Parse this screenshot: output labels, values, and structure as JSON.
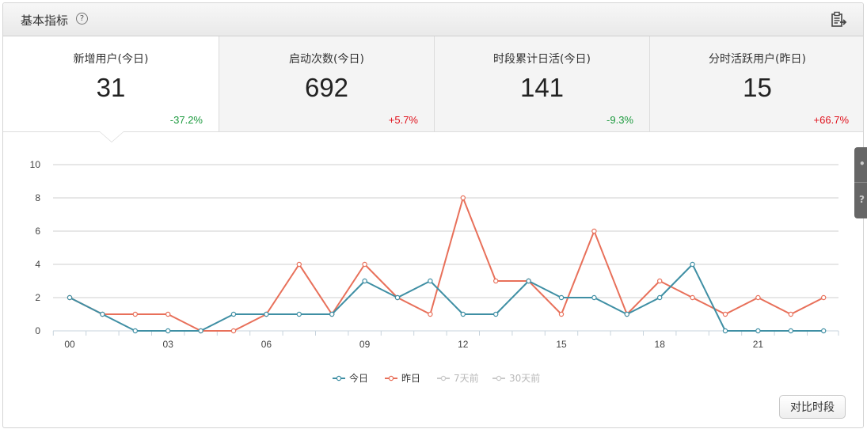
{
  "header": {
    "title": "基本指标",
    "help_icon": "?"
  },
  "kpis": [
    {
      "label": "新增用户(今日)",
      "value": "31",
      "change": "-37.2%",
      "trend": "down"
    },
    {
      "label": "启动次数(今日)",
      "value": "692",
      "change": "+5.7%",
      "trend": "up"
    },
    {
      "label": "时段累计日活(今日)",
      "value": "141",
      "change": "-9.3%",
      "trend": "down"
    },
    {
      "label": "分时活跃用户(昨日)",
      "value": "15",
      "change": "+66.7%",
      "trend": "up"
    }
  ],
  "compare_button": "对比时段",
  "colors": {
    "today": "#3f8fa4",
    "yesterday": "#e8705a",
    "inactive": "#c9c9c9",
    "grid": "#cfcfcf"
  },
  "chart_data": {
    "type": "line",
    "x": [
      "00",
      "01",
      "02",
      "03",
      "04",
      "05",
      "06",
      "07",
      "08",
      "09",
      "10",
      "11",
      "12",
      "13",
      "14",
      "15",
      "16",
      "17",
      "18",
      "19",
      "20",
      "21",
      "22",
      "23"
    ],
    "tick_labels": [
      "00",
      "03",
      "06",
      "09",
      "12",
      "15",
      "18",
      "21"
    ],
    "ylim": [
      0,
      10
    ],
    "yticks": [
      "0",
      "2",
      "4",
      "6",
      "8",
      "10"
    ],
    "grid": true,
    "legend_position": "bottom",
    "series": [
      {
        "name": "今日",
        "active": true,
        "values": [
          2,
          1,
          0,
          0,
          0,
          1,
          1,
          1,
          1,
          3,
          2,
          3,
          1,
          1,
          3,
          2,
          2,
          1,
          2,
          4,
          0,
          0,
          0,
          0
        ]
      },
      {
        "name": "昨日",
        "active": true,
        "values": [
          2,
          1,
          1,
          1,
          0,
          0,
          1,
          4,
          1,
          4,
          2,
          1,
          8,
          3,
          3,
          1,
          6,
          1,
          3,
          2,
          1,
          2,
          1,
          2
        ]
      },
      {
        "name": "7天前",
        "active": false,
        "values": []
      },
      {
        "name": "30天前",
        "active": false,
        "values": []
      }
    ]
  }
}
